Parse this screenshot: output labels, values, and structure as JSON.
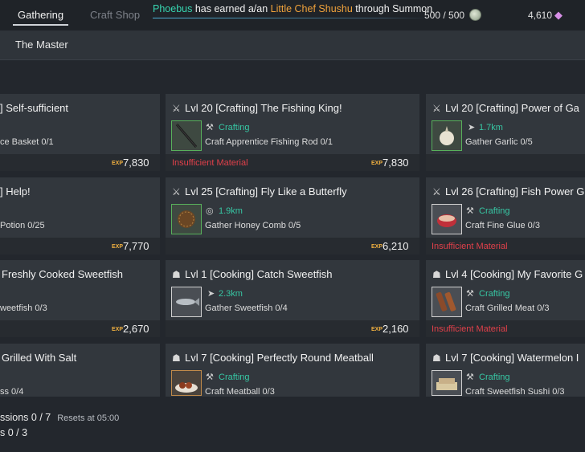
{
  "tabs": {
    "gathering": "Gathering",
    "craft_shop": "Craft Shop"
  },
  "notification": {
    "player": "Phoebus",
    "pre": " has earned a/an ",
    "item": "Little Chef Shushu",
    "post": " through Summon"
  },
  "currency": {
    "counter": "500 / 500",
    "gems": "4,610"
  },
  "subheader": {
    "title": "The Master"
  },
  "cards": {
    "c1": {
      "title": "] Self-sufficient",
      "req": "ce Basket 0/1",
      "reward": "7,830"
    },
    "c2": {
      "title": "Lvl 20  [Crafting] The Fishing King!",
      "req_type": "Crafting",
      "req": "Craft Apprentice Fishing Rod 0/1",
      "reward": "7,830",
      "status": "Insufficient Material"
    },
    "c3": {
      "title": "Lvl 20  [Crafting] Power of Ga",
      "req_type": "1.7km",
      "req": "Gather Garlic 0/5"
    },
    "c4": {
      "title": "] Help!",
      "req": "Potion 0/25",
      "reward": "7,770"
    },
    "c5": {
      "title": "Lvl 25  [Crafting] Fly Like a Butterfly",
      "req_type": "1.9km",
      "req": "Gather Honey Comb 0/5",
      "reward": "6,210"
    },
    "c6": {
      "title": "Lvl 26  [Crafting] Fish Power G",
      "req_type": "Crafting",
      "req": "Craft Fine Glue 0/3",
      "status": "Insufficient Material"
    },
    "c7": {
      "title": "Freshly Cooked Sweetfish",
      "req": "weetfish 0/3",
      "reward": "2,670"
    },
    "c8": {
      "title": "Lvl 1  [Cooking] Catch Sweetfish",
      "req_type": "2.3km",
      "req": "Gather Sweetfish 0/4",
      "reward": "2,160"
    },
    "c9": {
      "title": "Lvl 4  [Cooking] My Favorite G",
      "req_type": "Crafting",
      "req": "Craft Grilled Meat 0/3",
      "status": "Insufficient Material"
    },
    "c10": {
      "title": "Grilled With Salt",
      "req": "ss 0/4"
    },
    "c11": {
      "title": "Lvl 7  [Cooking] Perfectly Round Meatball",
      "req_type": "Crafting",
      "req": "Craft Meatball 0/3"
    },
    "c12": {
      "title": "Lvl 7  [Cooking] Watermelon I",
      "req_type": "Crafting",
      "req": "Craft Sweetfish Sushi 0/3"
    }
  },
  "bottom": {
    "missions": "ssions 0 / 7",
    "resets": "Resets at 05:00",
    "line2": "s 0 / 3"
  },
  "icons": {
    "craft": "crossed-tools-icon",
    "cook": "chef-hat-icon",
    "distance": "arrow-icon",
    "exp": "exp-icon"
  }
}
